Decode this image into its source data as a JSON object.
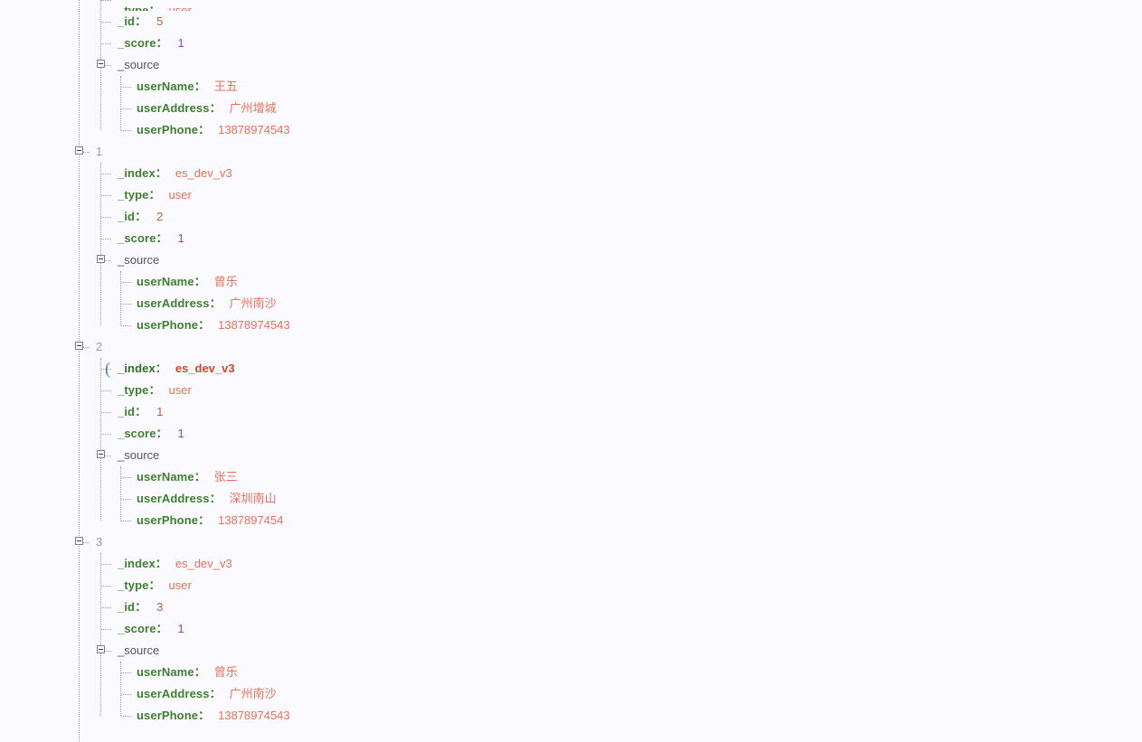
{
  "viewer": {
    "kind": "json-tree-viewer",
    "background_color": "#fafaff",
    "colors": {
      "key": "#3f7f2f",
      "string_value": "#e8705a",
      "id_value": "#c06030",
      "score_value": "#9a3fc0",
      "node_index": "#9a9a9a",
      "object_label": "#555555",
      "guide_line": "#9a9a9a",
      "caret": "#5a7fd0",
      "selected_value": "#d0452c"
    },
    "toggle_icon": "minus-box-icon",
    "caret_icon": "text-caret-icon"
  },
  "rows": [
    {
      "id": "r0",
      "depth": 2,
      "kind": "pair",
      "key": "_type",
      "colon": "：",
      "value": "user",
      "value_kind": "string",
      "clipped": true,
      "toggle": false,
      "selected": false
    },
    {
      "id": "r1",
      "depth": 2,
      "kind": "pair",
      "key": "_id",
      "colon": "：",
      "value": "5",
      "value_kind": "id",
      "clipped": false,
      "toggle": false,
      "selected": false
    },
    {
      "id": "r2",
      "depth": 2,
      "kind": "pair",
      "key": "_score",
      "colon": "：",
      "value": "1",
      "value_kind": "score",
      "clipped": false,
      "toggle": false,
      "selected": false
    },
    {
      "id": "r3",
      "depth": 2,
      "kind": "object",
      "key": "_source",
      "colon": "",
      "value": "",
      "value_kind": "none",
      "clipped": false,
      "toggle": true,
      "selected": false
    },
    {
      "id": "r4",
      "depth": 3,
      "kind": "pair",
      "key": "userName",
      "colon": "：",
      "value": "王五",
      "value_kind": "string",
      "clipped": false,
      "toggle": false,
      "selected": false
    },
    {
      "id": "r5",
      "depth": 3,
      "kind": "pair",
      "key": "userAddress",
      "colon": "：",
      "value": "广州增城",
      "value_kind": "string",
      "clipped": false,
      "toggle": false,
      "selected": false
    },
    {
      "id": "r6",
      "depth": 3,
      "kind": "pair",
      "key": "userPhone",
      "colon": "：",
      "value": "13878974543",
      "value_kind": "string",
      "clipped": false,
      "toggle": false,
      "selected": false
    },
    {
      "id": "r7",
      "depth": 1,
      "kind": "node",
      "key": "1",
      "colon": "",
      "value": "",
      "value_kind": "none",
      "clipped": false,
      "toggle": true,
      "selected": false
    },
    {
      "id": "r8",
      "depth": 2,
      "kind": "pair",
      "key": "_index",
      "colon": "：",
      "value": "es_dev_v3",
      "value_kind": "string",
      "clipped": false,
      "toggle": false,
      "selected": false
    },
    {
      "id": "r9",
      "depth": 2,
      "kind": "pair",
      "key": "_type",
      "colon": "：",
      "value": "user",
      "value_kind": "string",
      "clipped": false,
      "toggle": false,
      "selected": false
    },
    {
      "id": "r10",
      "depth": 2,
      "kind": "pair",
      "key": "_id",
      "colon": "：",
      "value": "2",
      "value_kind": "id",
      "clipped": false,
      "toggle": false,
      "selected": false
    },
    {
      "id": "r11",
      "depth": 2,
      "kind": "pair",
      "key": "_score",
      "colon": "：",
      "value": "1",
      "value_kind": "score",
      "clipped": false,
      "toggle": false,
      "selected": false
    },
    {
      "id": "r12",
      "depth": 2,
      "kind": "object",
      "key": "_source",
      "colon": "",
      "value": "",
      "value_kind": "none",
      "clipped": false,
      "toggle": true,
      "selected": false
    },
    {
      "id": "r13",
      "depth": 3,
      "kind": "pair",
      "key": "userName",
      "colon": "：",
      "value": "曾乐",
      "value_kind": "string",
      "clipped": false,
      "toggle": false,
      "selected": false
    },
    {
      "id": "r14",
      "depth": 3,
      "kind": "pair",
      "key": "userAddress",
      "colon": "：",
      "value": "广州南沙",
      "value_kind": "string",
      "clipped": false,
      "toggle": false,
      "selected": false
    },
    {
      "id": "r15",
      "depth": 3,
      "kind": "pair",
      "key": "userPhone",
      "colon": "：",
      "value": "13878974543",
      "value_kind": "string",
      "clipped": false,
      "toggle": false,
      "selected": false
    },
    {
      "id": "r16",
      "depth": 1,
      "kind": "node",
      "key": "2",
      "colon": "",
      "value": "",
      "value_kind": "none",
      "clipped": false,
      "toggle": true,
      "selected": false
    },
    {
      "id": "r17",
      "depth": 2,
      "kind": "pair",
      "key": "_index",
      "colon": "：",
      "value": "es_dev_v3",
      "value_kind": "string",
      "clipped": false,
      "toggle": false,
      "selected": true
    },
    {
      "id": "r18",
      "depth": 2,
      "kind": "pair",
      "key": "_type",
      "colon": "：",
      "value": "user",
      "value_kind": "string",
      "clipped": false,
      "toggle": false,
      "selected": false
    },
    {
      "id": "r19",
      "depth": 2,
      "kind": "pair",
      "key": "_id",
      "colon": "：",
      "value": "1",
      "value_kind": "id",
      "clipped": false,
      "toggle": false,
      "selected": false
    },
    {
      "id": "r20",
      "depth": 2,
      "kind": "pair",
      "key": "_score",
      "colon": "：",
      "value": "1",
      "value_kind": "score",
      "clipped": false,
      "toggle": false,
      "selected": false
    },
    {
      "id": "r21",
      "depth": 2,
      "kind": "object",
      "key": "_source",
      "colon": "",
      "value": "",
      "value_kind": "none",
      "clipped": false,
      "toggle": true,
      "selected": false
    },
    {
      "id": "r22",
      "depth": 3,
      "kind": "pair",
      "key": "userName",
      "colon": "：",
      "value": "张三",
      "value_kind": "string",
      "clipped": false,
      "toggle": false,
      "selected": false
    },
    {
      "id": "r23",
      "depth": 3,
      "kind": "pair",
      "key": "userAddress",
      "colon": "：",
      "value": "深圳南山",
      "value_kind": "string",
      "clipped": false,
      "toggle": false,
      "selected": false
    },
    {
      "id": "r24",
      "depth": 3,
      "kind": "pair",
      "key": "userPhone",
      "colon": "：",
      "value": "1387897454",
      "value_kind": "string",
      "clipped": false,
      "toggle": false,
      "selected": false
    },
    {
      "id": "r25",
      "depth": 1,
      "kind": "node",
      "key": "3",
      "colon": "",
      "value": "",
      "value_kind": "none",
      "clipped": false,
      "toggle": true,
      "selected": false
    },
    {
      "id": "r26",
      "depth": 2,
      "kind": "pair",
      "key": "_index",
      "colon": "：",
      "value": "es_dev_v3",
      "value_kind": "string",
      "clipped": false,
      "toggle": false,
      "selected": false
    },
    {
      "id": "r27",
      "depth": 2,
      "kind": "pair",
      "key": "_type",
      "colon": "：",
      "value": "user",
      "value_kind": "string",
      "clipped": false,
      "toggle": false,
      "selected": false
    },
    {
      "id": "r28",
      "depth": 2,
      "kind": "pair",
      "key": "_id",
      "colon": "：",
      "value": "3",
      "value_kind": "id",
      "clipped": false,
      "toggle": false,
      "selected": false
    },
    {
      "id": "r29",
      "depth": 2,
      "kind": "pair",
      "key": "_score",
      "colon": "：",
      "value": "1",
      "value_kind": "score",
      "clipped": false,
      "toggle": false,
      "selected": false
    },
    {
      "id": "r30",
      "depth": 2,
      "kind": "object",
      "key": "_source",
      "colon": "",
      "value": "",
      "value_kind": "none",
      "clipped": false,
      "toggle": true,
      "selected": false
    },
    {
      "id": "r31",
      "depth": 3,
      "kind": "pair",
      "key": "userName",
      "colon": "：",
      "value": "曾乐",
      "value_kind": "string",
      "clipped": false,
      "toggle": false,
      "selected": false
    },
    {
      "id": "r32",
      "depth": 3,
      "kind": "pair",
      "key": "userAddress",
      "colon": "：",
      "value": "广州南沙",
      "value_kind": "string",
      "clipped": false,
      "toggle": false,
      "selected": false
    },
    {
      "id": "r33",
      "depth": 3,
      "kind": "pair",
      "key": "userPhone",
      "colon": "：",
      "value": "13878974543",
      "value_kind": "string",
      "clipped": false,
      "toggle": false,
      "selected": false
    }
  ]
}
